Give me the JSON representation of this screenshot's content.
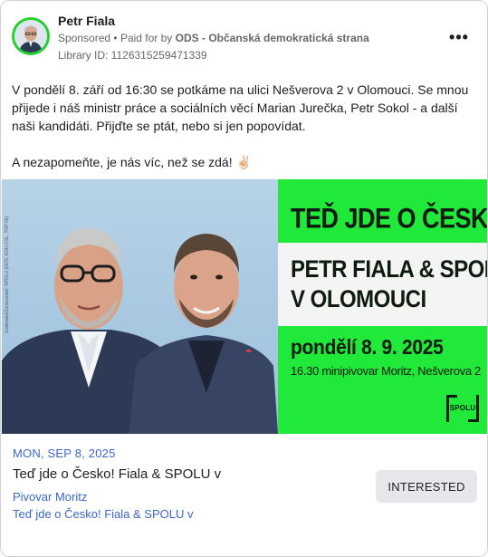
{
  "header": {
    "page_name": "Petr Fiala",
    "sponsored_label": "Sponsored",
    "separator": "•",
    "paid_prefix": "Paid for by",
    "paid_by": "ODS - Občanská demokratická strana",
    "library_id": "Library ID: 1126315259471339",
    "more_label": "•••"
  },
  "post": {
    "paragraph_1": "V pondělí 8. září od 16:30 se potkáme na ulici Nešverova 2 v Olomouci. Se mnou přijede i náš ministr práce a sociálních věcí Marian Jurečka, Petr Sokol - a další naši kandidáti. Přijďte se ptát, nebo si jen popovídat.",
    "paragraph_2": "A nezapomeňte, je nás víc, než se zdá! ✌🏻"
  },
  "creative": {
    "headline_1": "TEĎ JDE O ČESKO!",
    "headline_2_line_1": "PETR FIALA & SPOLU",
    "headline_2_line_2": "V OLOMOUCI",
    "date": "pondělí 8. 9. 2025",
    "venue": "16.30 minipivovar Moritz, Nešverova 2",
    "logo_text": "SPOLU",
    "side_note": "Zadavatel/Zpracovatel: SPOLU (ODS, KDU-ČSL, TOP 09)",
    "colors": {
      "green": "#21e93a",
      "dark": "#0f1a10"
    }
  },
  "event": {
    "date": "MON, SEP 8, 2025",
    "title": "Teď jde o Česko! Fiala & SPOLU v",
    "place": "Pivovar Moritz",
    "subtitle": "Teď jde o Česko! Fiala & SPOLU v",
    "button_label": "INTERESTED"
  }
}
